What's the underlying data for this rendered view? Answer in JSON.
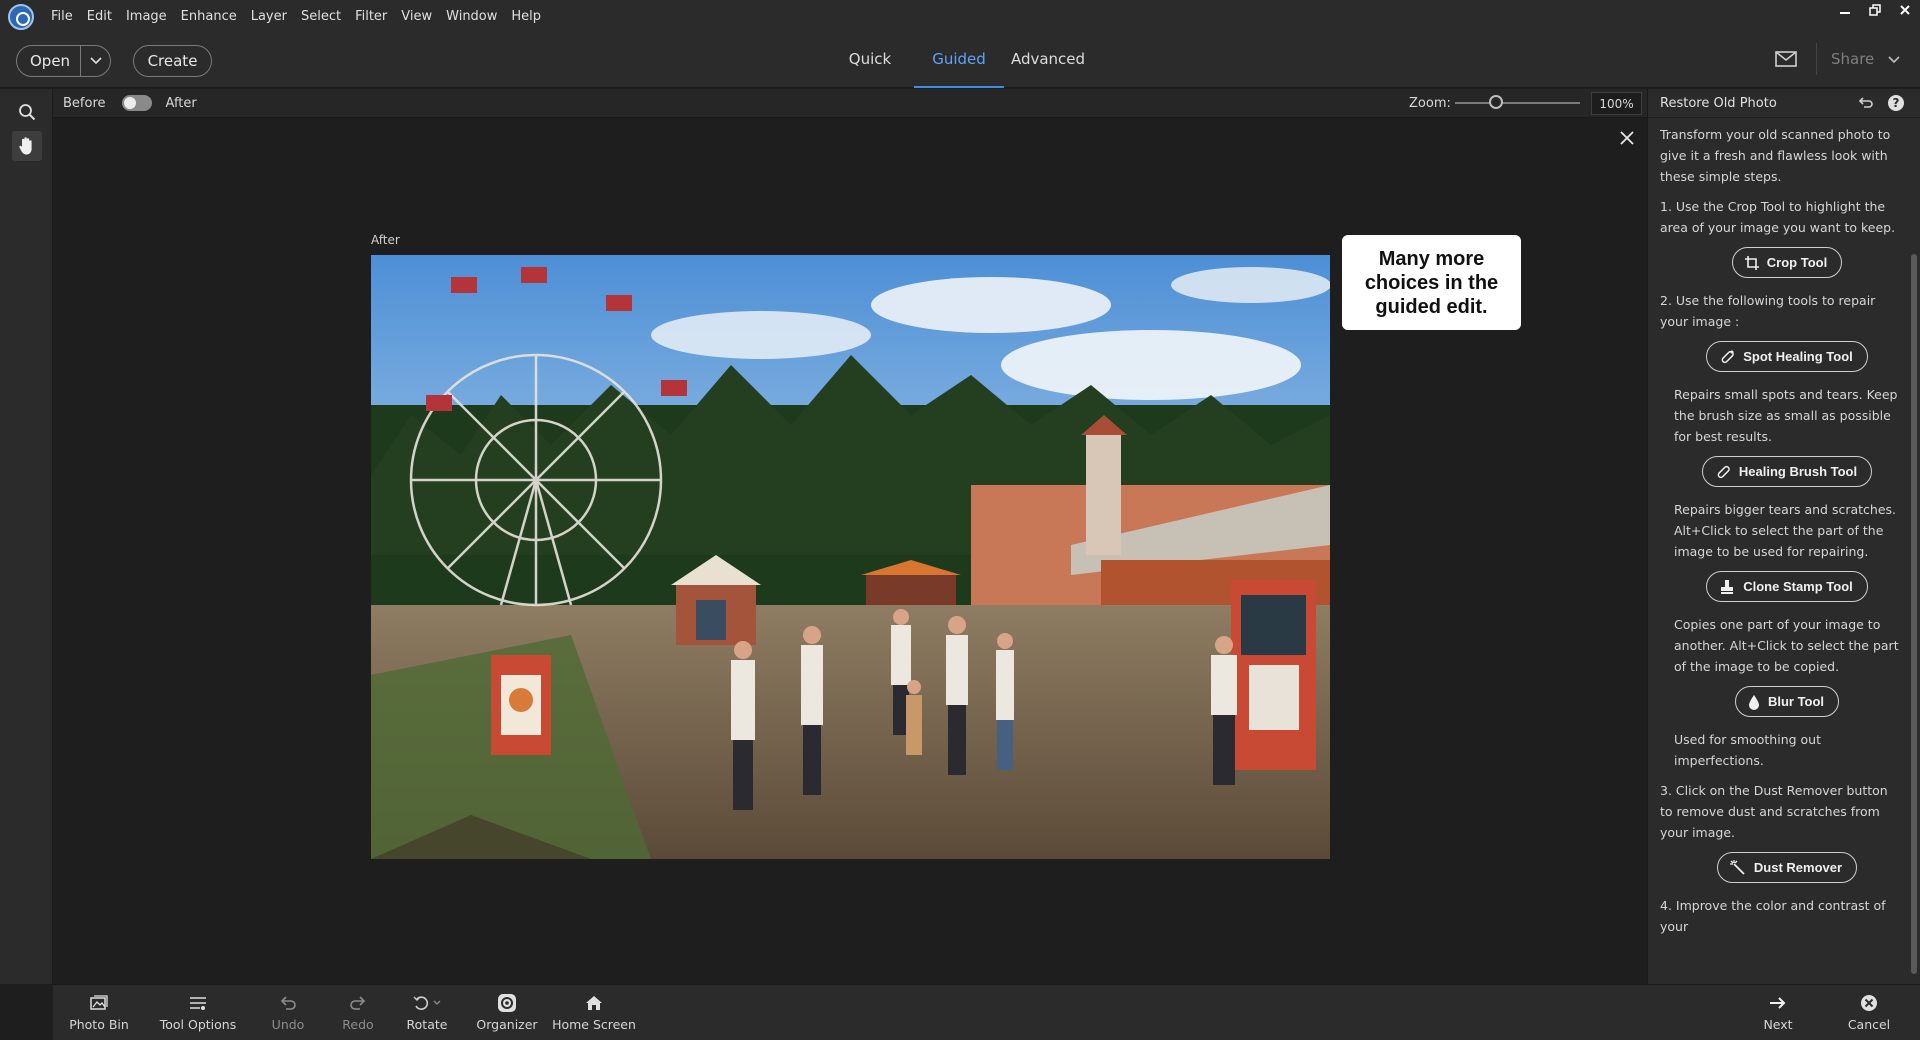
{
  "menubar": {
    "items": [
      "File",
      "Edit",
      "Image",
      "Enhance",
      "Layer",
      "Select",
      "Filter",
      "View",
      "Window",
      "Help"
    ]
  },
  "toolbar": {
    "open_label": "Open",
    "create_label": "Create",
    "tabs": [
      "Quick",
      "Guided",
      "Advanced"
    ],
    "active_tab": "Guided",
    "share_label": "Share"
  },
  "viewbar": {
    "before_label": "Before",
    "after_label": "After",
    "zoom_label": "Zoom:",
    "zoom_value": "100%",
    "zoom_fraction": 0.33
  },
  "canvas": {
    "image_label": "After",
    "callout": "Many more choices in the guided edit."
  },
  "panel": {
    "title": "Restore Old Photo",
    "intro": "Transform your old scanned photo to give it a fresh and flawless look with these simple steps.",
    "step1": "1. Use the Crop Tool to highlight the area of your image you want to keep.",
    "crop_tool": "Crop Tool",
    "step2": "2. Use the following tools to repair your image :",
    "spot_healing_tool": "Spot Healing Tool",
    "spot_healing_desc": "Repairs small spots and tears. Keep the brush size as small as possible for best results.",
    "healing_brush_tool": "Healing Brush Tool",
    "healing_brush_desc": "Repairs bigger tears and scratches. Alt+Click to select the part of the image to be used for repairing.",
    "clone_stamp_tool": "Clone Stamp Tool",
    "clone_stamp_desc": "Copies one part of your image to another. Alt+Click to select the part of the image to be copied.",
    "blur_tool": "Blur Tool",
    "blur_desc": "Used for smoothing out imperfections.",
    "step3": "3. Click on the Dust Remover button to remove dust and scratches from your image.",
    "dust_remover": "Dust Remover",
    "step4": "4. Improve the color and contrast of your"
  },
  "bottombar": {
    "photo_bin": "Photo Bin",
    "tool_options": "Tool Options",
    "undo": "Undo",
    "redo": "Redo",
    "rotate": "Rotate",
    "organizer": "Organizer",
    "home_screen": "Home Screen",
    "next": "Next",
    "cancel": "Cancel"
  },
  "colors": {
    "accent": "#3d8ee6",
    "background": "#1e1e1e",
    "panel": "#2b2b2b"
  }
}
